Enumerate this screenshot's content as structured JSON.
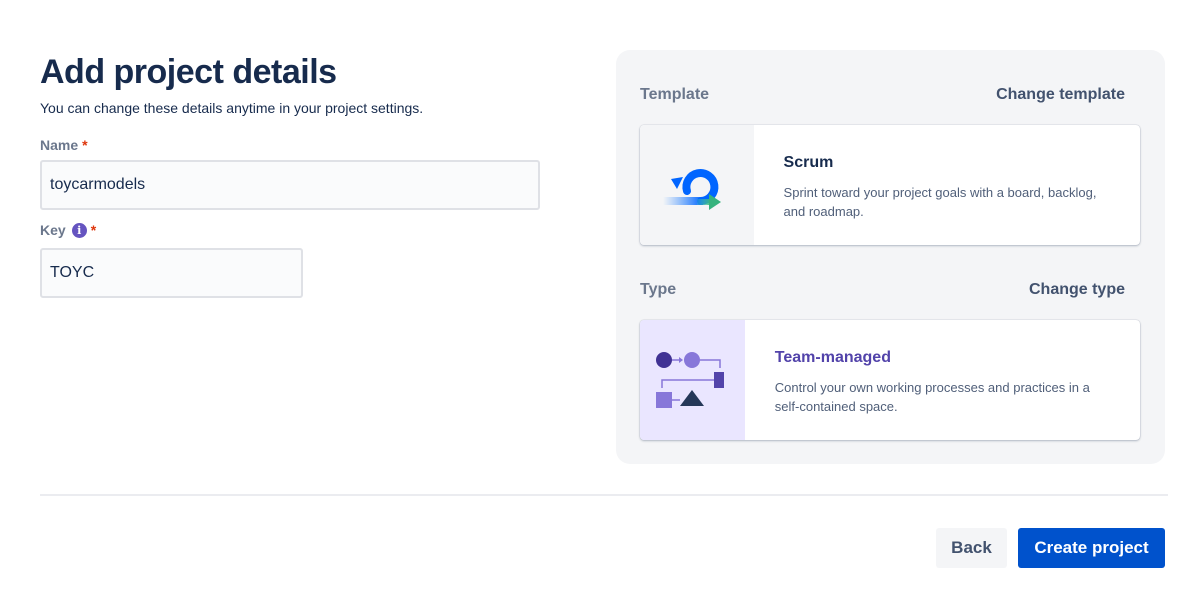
{
  "header": {
    "title": "Add project details",
    "subtitle": "You can change these details anytime in your project settings."
  },
  "form": {
    "name_label": "Name",
    "name_value": "toycarmodels",
    "key_label": "Key",
    "key_value": "TOYC",
    "required_marker": "*",
    "info_glyph": "i"
  },
  "template": {
    "section_label": "Template",
    "change_label": "Change template",
    "card_title": "Scrum",
    "card_description": "Sprint toward your project goals with a board, backlog, and roadmap.",
    "icon": "scrum-cycle-icon"
  },
  "type": {
    "section_label": "Type",
    "change_label": "Change type",
    "card_title": "Team-managed",
    "card_description": "Control your own working processes and practices in a self-contained space.",
    "icon": "team-managed-flow-icon"
  },
  "footer": {
    "back_label": "Back",
    "create_label": "Create project"
  },
  "colors": {
    "primary": "#0052cc",
    "heading": "#172b4d",
    "purple": "#6554c0",
    "team_card_bg": "#eae6ff",
    "required": "#de350b"
  }
}
